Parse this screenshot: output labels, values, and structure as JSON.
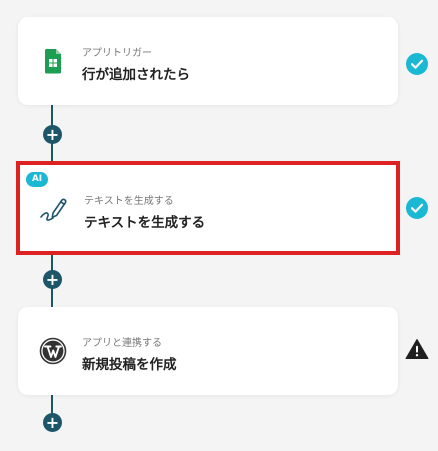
{
  "steps": [
    {
      "app": "アプリトリガー",
      "title": "行が追加されたら",
      "icon": "google-sheets-icon",
      "status": "complete"
    },
    {
      "badge": "AI",
      "app": "テキストを生成する",
      "title": "テキストを生成する",
      "icon": "pen-write-icon",
      "status": "complete"
    },
    {
      "app": "アプリと連携する",
      "title": "新規投稿を作成",
      "icon": "wordpress-icon",
      "status": "warning"
    }
  ],
  "add_button_label": "+",
  "colors": {
    "connector": "#1d5569",
    "check": "#1ab8d2",
    "sheets_green": "#1e9e52",
    "selected_outline": "#dd2222"
  }
}
